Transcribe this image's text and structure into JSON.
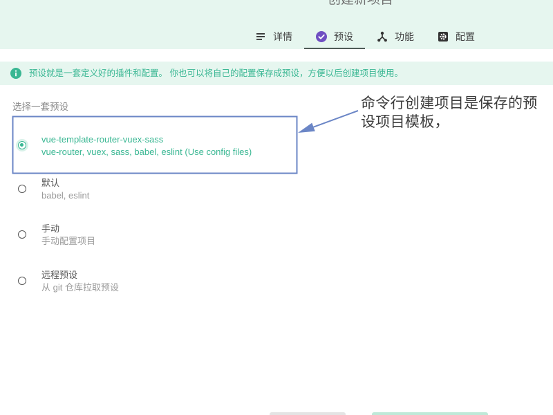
{
  "page": {
    "title": "创建新项目"
  },
  "tabs": [
    {
      "label": "详情",
      "icon": "subject-icon",
      "active": false
    },
    {
      "label": "预设",
      "icon": "check-circle-icon",
      "active": true
    },
    {
      "label": "功能",
      "icon": "fork-icon",
      "active": false
    },
    {
      "label": "配置",
      "icon": "settings-icon",
      "active": false
    }
  ],
  "info": {
    "icon": "info-icon",
    "text": "预设就是一套定义好的插件和配置。 你也可以将自己的配置保存成预设，方便以后创建项目使用。"
  },
  "presets": {
    "heading": "选择一套预设",
    "items": [
      {
        "name": "vue-template-router-vuex-sass",
        "description": "vue-router, vuex, sass, babel, eslint (Use config files)",
        "selected": true
      },
      {
        "name": "默认",
        "description": "babel, eslint",
        "selected": false
      },
      {
        "name": "手动",
        "description": "手动配置项目",
        "selected": false
      },
      {
        "name": "远程预设",
        "description": "从 git 仓库拉取预设",
        "selected": false
      }
    ]
  },
  "annotation": {
    "lines": [
      "命令行创建项目是保存的预",
      "设项目模板，"
    ]
  },
  "colors": {
    "accent": "#3ab793",
    "active_tab_icon": "#6f4fc2",
    "header_background": "#e6f6ef",
    "annotation": "#6b86c6"
  }
}
